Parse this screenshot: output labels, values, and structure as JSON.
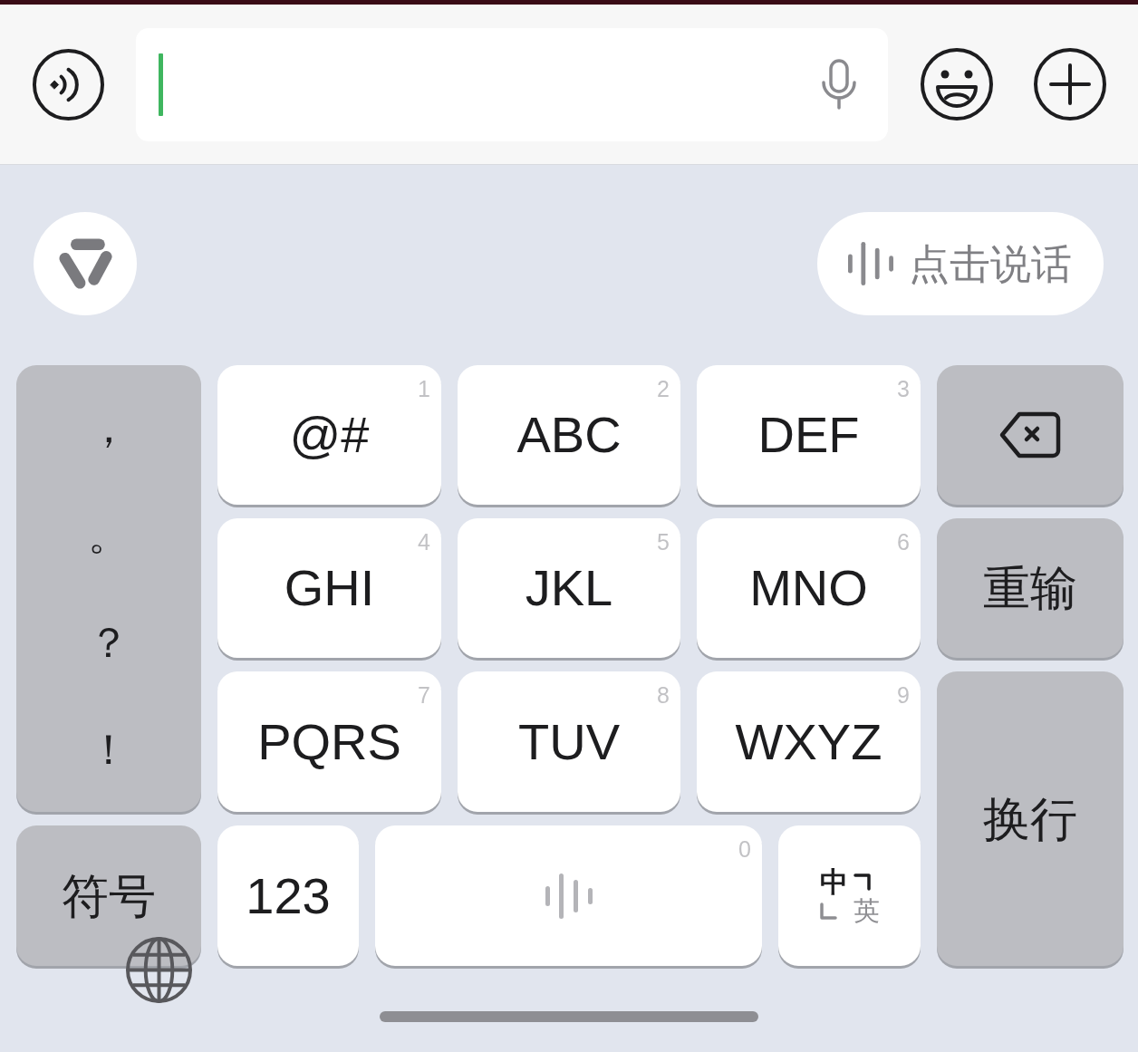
{
  "message_bar": {
    "input": {
      "focused": true
    }
  },
  "assistant_row": {
    "talk_button": {
      "label": "点击说话"
    }
  },
  "keyboard": {
    "punctuation": [
      "，",
      "。",
      "？",
      "！"
    ],
    "letter_keys": [
      {
        "label": "@#",
        "digit": "1"
      },
      {
        "label": "ABC",
        "digit": "2"
      },
      {
        "label": "DEF",
        "digit": "3"
      },
      {
        "label": "GHI",
        "digit": "4"
      },
      {
        "label": "JKL",
        "digit": "5"
      },
      {
        "label": "MNO",
        "digit": "6"
      },
      {
        "label": "PQRS",
        "digit": "7"
      },
      {
        "label": "TUV",
        "digit": "8"
      },
      {
        "label": "WXYZ",
        "digit": "9"
      }
    ],
    "side_keys": [
      {
        "kind": "backspace"
      },
      {
        "kind": "text",
        "label": "重输"
      },
      {
        "kind": "text",
        "label": "换行"
      }
    ],
    "symbol_key": {
      "label": "符号"
    },
    "bottom_keys": [
      {
        "kind": "text",
        "label": "123"
      },
      {
        "kind": "space",
        "digit": "0"
      },
      {
        "kind": "language",
        "options": [
          {
            "label": "中",
            "selected": true
          },
          {
            "label": "英",
            "selected": false
          }
        ]
      }
    ]
  }
}
